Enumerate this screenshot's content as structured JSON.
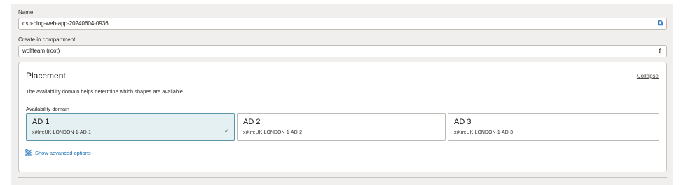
{
  "name_field": {
    "label": "Name",
    "value": "dsp-blog-web-app-20240604-0936",
    "icon": "copy-icon"
  },
  "compartment_field": {
    "label": "Create in compartment",
    "value": "wolfteam (root)",
    "icon": "chevron-updown-icon"
  },
  "placement": {
    "title": "Placement",
    "collapse_label": "Collapse",
    "description": "The availability domain helps determine which shapes are available.",
    "ad_label": "Availability domain",
    "domains": [
      {
        "name": "AD 1",
        "id": "xiXm:UK-LONDON-1-AD-1",
        "selected": true
      },
      {
        "name": "AD 2",
        "id": "xiXm:UK-LONDON-1-AD-2",
        "selected": false
      },
      {
        "name": "AD 3",
        "id": "xiXm:UK-LONDON-1-AD-3",
        "selected": false
      }
    ],
    "advanced_label": "Show advanced options"
  },
  "colors": {
    "accent": "#1a6cb6",
    "selected_bg": "#e4f0f2",
    "selected_border": "#5a96a8",
    "panel_bg": "#f1efed"
  }
}
